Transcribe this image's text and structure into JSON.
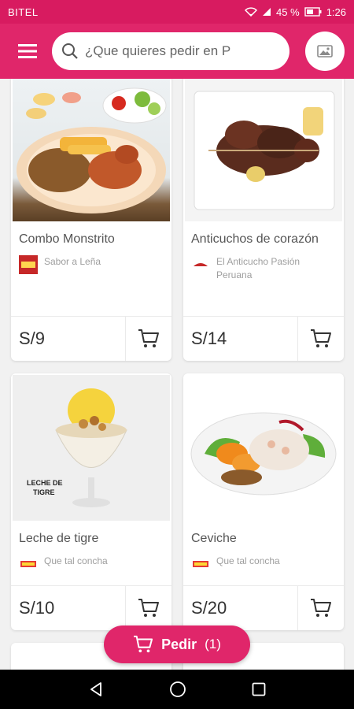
{
  "status_bar": {
    "carrier": "BITEL",
    "battery": "45 %",
    "time": "1:26"
  },
  "search": {
    "placeholder": "¿Que quieres pedir en P"
  },
  "products": [
    {
      "name": "Combo Monstrito",
      "store": "Sabor a Leña",
      "price": "S/9"
    },
    {
      "name": "Anticuchos de corazón",
      "store": "El Anticucho Pasión Peruana",
      "price": "S/14"
    },
    {
      "name": "Leche de tigre",
      "store": "Que tal concha",
      "price": "S/10",
      "photo_caption": "LECHE DE TIGRE"
    },
    {
      "name": "Ceviche",
      "store": "Que tal concha",
      "price": "S/20"
    }
  ],
  "order_button": {
    "label": "Pedir",
    "count": "(1)"
  },
  "colors": {
    "primary": "#e0266a",
    "status_bar": "#d81b60",
    "background": "#f1f1f1"
  },
  "icons": [
    "menu-icon",
    "search-icon",
    "image-icon",
    "cart-icon",
    "back-icon",
    "home-icon",
    "recents-icon"
  ]
}
